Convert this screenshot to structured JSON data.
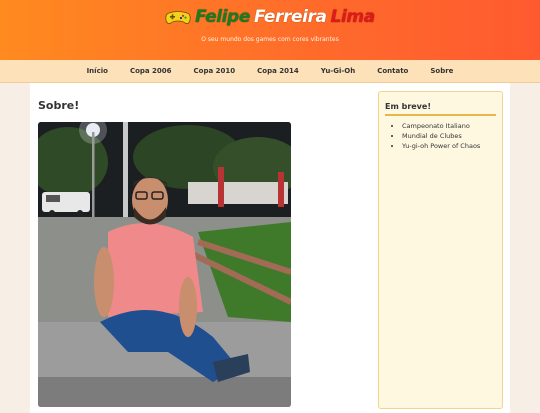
{
  "site": {
    "title_parts": [
      "Felipe",
      "Ferreira",
      "Lima"
    ],
    "subtitle": "O seu mundo dos games com cores vibrantes"
  },
  "nav": {
    "items": [
      "Início",
      "Copa 2006",
      "Copa 2010",
      "Copa 2014",
      "Yu-Gi-Oh",
      "Contato",
      "Sobre"
    ]
  },
  "main": {
    "heading": "Sobre!"
  },
  "sidebar": {
    "heading": "Em breve!",
    "items": [
      "Campeonato Italiano",
      "Mundial de Clubes",
      "Yu-gi-oh Power of Chaos"
    ]
  },
  "icons": {
    "logo": "game-controller-icon"
  },
  "colors": {
    "header_start": "#ff8a1f",
    "header_end": "#ff5a2f",
    "nav_bg": "#fde1b9",
    "title_green": "#1e7a21",
    "title_red": "#e01919",
    "sidebar_bg": "#fff8e0",
    "sidebar_border": "#e8b64c"
  }
}
